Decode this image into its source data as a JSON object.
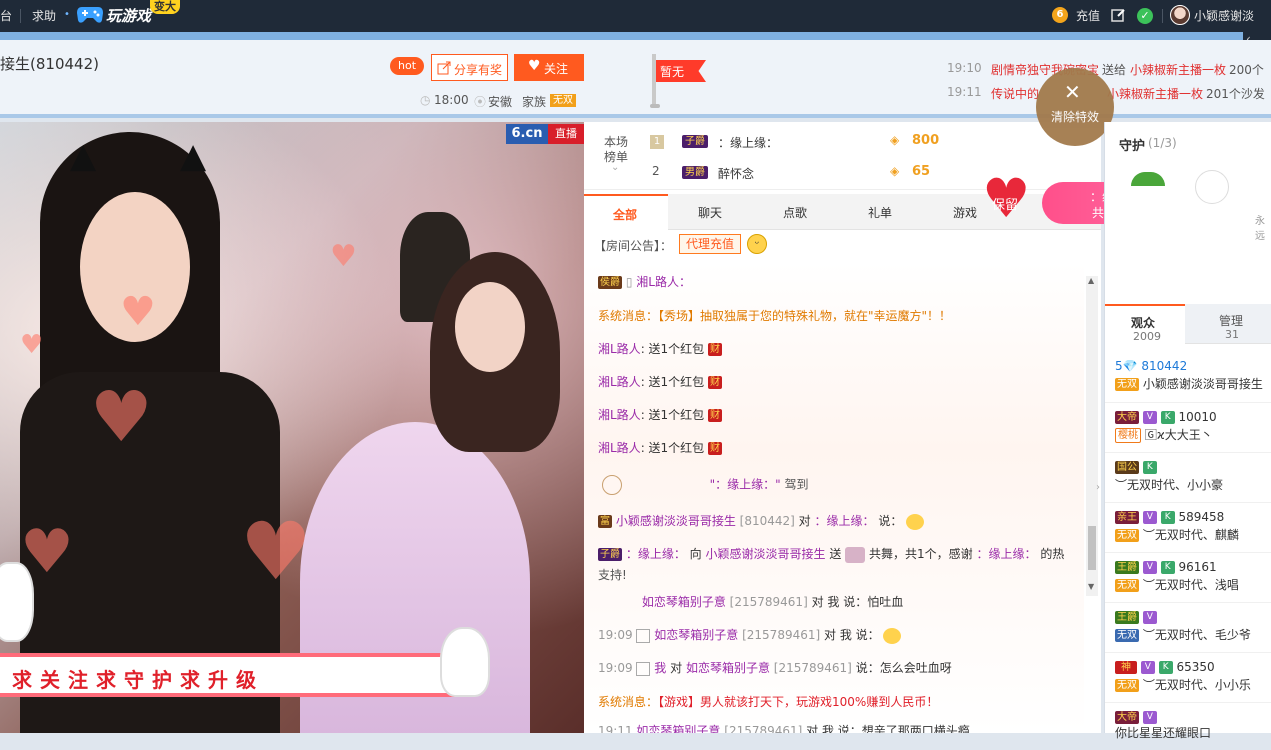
{
  "topbar": {
    "left1": "台",
    "left2": "求助",
    "game_logo": "玩游戏",
    "game_badge": "变大",
    "coin_icon": "6",
    "recharge": "充值",
    "username": "小颖感谢淡"
  },
  "header": {
    "title": "接生(810442)",
    "hot": "hot",
    "share": "分享有奖",
    "follow": "关注",
    "time": "18:00",
    "location": "安徽",
    "family_label": "家族",
    "family_value": "无双",
    "flag": "暂无",
    "feed": [
      {
        "time": "19:10",
        "text": "剧情帝独守我碗密宝",
        "mid": "送给",
        "target": "小辣椒新主播一枚",
        "tail": "200个"
      },
      {
        "time": "19:11",
        "text": "传说中的",
        "mid": "",
        "target": "小辣椒新主播一枚",
        "tail": "201个沙发"
      }
    ]
  },
  "video": {
    "logo": "6.cn",
    "live": "直播",
    "banner": "求关注求守护求升级"
  },
  "rank": {
    "title_a": "本场",
    "title_b": "榜单",
    "rows": [
      {
        "rank": "1",
        "badge": "子爵",
        "name": "：缘上缘：",
        "score": "800"
      },
      {
        "rank": "2",
        "badge": "男爵",
        "name": "醉怀念",
        "score": "65"
      }
    ]
  },
  "tabs": [
    "全部",
    "聊天",
    "点歌",
    "礼单",
    "游戏"
  ],
  "notice": {
    "label": "【房间公告】：",
    "btn": "代理充值"
  },
  "chat": {
    "l1_name": "湘L路人：",
    "l2_a": "系统消息：",
    "l2_b": "【秀场】抽取独属于您的特殊礼物，就在\"幸运魔方\"！！",
    "red_name": "湘L路人",
    "red_text": ": 送1个红包",
    "red_badge": "财",
    "arrive_name": "\"：缘上缘：\"",
    "arrive_text": "驾到",
    "l8_name": "小颖感谢淡淡哥哥接生",
    "l8_id": "[810442]",
    "l8_mid": "对",
    "l8_target": "：缘上缘：",
    "l8_tail": "说：",
    "l9_name": "：缘上缘：",
    "l9_a": "向",
    "l9_b": "小颖感谢淡淡哥哥接生",
    "l9_c": "送",
    "l9_d": "共舞，共1个，感谢",
    "l9_e": "：缘上缘：",
    "l9_f": "的热",
    "l9_g": "支持!",
    "l10_name": "如恋琴箱别子意",
    "l10_id": "[215789461]",
    "l10_tail": "对 我 说：怕吐血",
    "l11_time": "19:09",
    "l11_name": "如恋琴箱别子意",
    "l11_id": "[215789461]",
    "l11_tail": "对 我 说：",
    "l12_time": "19:09",
    "l12_a": "我",
    "l12_b": "对",
    "l12_c": "如恋琴箱别子意",
    "l12_d": "[215789461]",
    "l12_e": "说：怎么会吐血呀",
    "l13_a": "系统消息：",
    "l13_b": "【游戏】男人就该打天下，玩游戏100%赚到人民币！",
    "l14_time": "19:11",
    "l14_name": "如恋琴箱别子意",
    "l14_id": "[215789461]",
    "l14_tail": "对 我 说：想亲了那两口横头瘾"
  },
  "effects": {
    "clear": "清除特效",
    "keep": "保留",
    "gift_name": "：缘上缘：",
    "gift_text": "共舞",
    "gift_count": "1个"
  },
  "guard": {
    "label": "守护",
    "count": "(1/3)",
    "forever": "永远"
  },
  "audience": {
    "tab1": "观众",
    "tab1_count": "2009",
    "tab2": "管理",
    "tab2_count": "31",
    "rows": [
      {
        "top": "5💎 810442",
        "bottom": "小颖感谢淡淡哥哥接生",
        "tag": "无双"
      },
      {
        "top": "10010",
        "bottom": "🄶ϰ大大王丶",
        "tag": "樱桃"
      },
      {
        "top": "",
        "bottom": "︶无双时代、小小豪",
        "tag": ""
      },
      {
        "top": "589458",
        "bottom": "︶无双时代、麒麟",
        "tag": "无双"
      },
      {
        "top": "96161",
        "bottom": "︶无双时代、浅唱",
        "tag": "无双"
      },
      {
        "top": "",
        "bottom": "︶无双时代、毛少爷",
        "tag": "无双"
      },
      {
        "top": "65350",
        "bottom": "︶无双时代、小小乐",
        "tag": "无双"
      },
      {
        "top": "",
        "bottom": "你比星星还耀眼口",
        "tag": ""
      }
    ]
  },
  "colors": {
    "accent": "#ff5a1f",
    "topbar": "#1f2a38",
    "purple": "#9a2aa8",
    "orange": "#e07a00"
  }
}
